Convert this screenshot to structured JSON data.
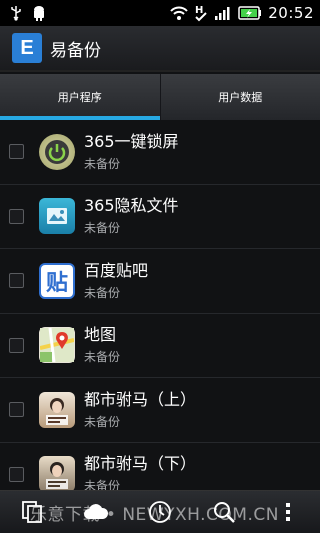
{
  "status_bar": {
    "time": "20:52",
    "icons": [
      "usb-icon",
      "android-debug-icon",
      "wifi-icon",
      "h-network-icon",
      "signal-icon",
      "battery-charging-icon"
    ]
  },
  "app_bar": {
    "logo_letter": "E",
    "title": "易备份"
  },
  "tabs": [
    {
      "label": "用户程序",
      "active": true
    },
    {
      "label": "用户数据",
      "active": false
    }
  ],
  "apps": [
    {
      "name": "365一键锁屏",
      "status": "未备份",
      "icon": "power-lock-icon"
    },
    {
      "name": "365隐私文件",
      "status": "未备份",
      "icon": "private-files-icon"
    },
    {
      "name": "百度贴吧",
      "status": "未备份",
      "icon": "tieba-icon",
      "icon_text": "贴"
    },
    {
      "name": "地图",
      "status": "未备份",
      "icon": "maps-icon"
    },
    {
      "name": "都市驸马（上）",
      "status": "未备份",
      "icon": "book-cover-icon"
    },
    {
      "name": "都市驸马（下）",
      "status": "未备份",
      "icon": "book-cover-icon"
    }
  ],
  "toolbar": {
    "buttons": [
      "copy-icon",
      "cloud-icon",
      "clock-icon",
      "search-icon",
      "more-icon"
    ]
  },
  "watermark": "乐意下载 • NEWYXH.COM.CN",
  "colors": {
    "accent": "#27a9e3",
    "logo": "#2a7fd6",
    "status_text": "#a8aaad"
  }
}
